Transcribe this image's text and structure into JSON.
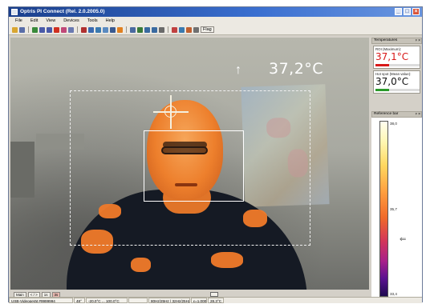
{
  "window": {
    "title": "Optris PI Connect (Rel. 2.0.2005.0)",
    "controls": [
      "_",
      "□",
      "×"
    ]
  },
  "menu": [
    "File",
    "Edit",
    "View",
    "Devices",
    "Tools",
    "Help"
  ],
  "toolbar": {
    "flag_label": "Flag",
    "icons": [
      {
        "name": "open-icon",
        "color": "#d9a630"
      },
      {
        "name": "save-icon",
        "color": "#5a6ea8"
      },
      {
        "name": "play-icon",
        "color": "#3a8a3a"
      },
      {
        "name": "pause-icon",
        "color": "#4a5aa8"
      },
      {
        "name": "stop-icon",
        "color": "#4a5aa8"
      },
      {
        "name": "record-icon",
        "color": "#d03020"
      },
      {
        "name": "snapshot-icon",
        "color": "#c04878"
      },
      {
        "name": "camera-icon",
        "color": "#6a7ab0"
      },
      {
        "name": "palette-icon",
        "color": "#b03030"
      },
      {
        "name": "grid-icon",
        "color": "#3a6ab0"
      },
      {
        "name": "layout-icon",
        "color": "#3a7ab0"
      },
      {
        "name": "zoom-icon",
        "color": "#5a8ac0"
      },
      {
        "name": "measure-icon",
        "color": "#3a5a90"
      },
      {
        "name": "hotspot-icon",
        "color": "#e08020"
      },
      {
        "name": "line-icon",
        "color": "#4a6aa0"
      },
      {
        "name": "graph-icon",
        "color": "#3a7a3a"
      },
      {
        "name": "temp-scale-icon",
        "color": "#3a6aa0"
      },
      {
        "name": "temp-range-icon",
        "color": "#3a6aa0"
      },
      {
        "name": "temp-grid-icon",
        "color": "#6a6a6a"
      },
      {
        "name": "export-icon",
        "color": "#c04040"
      },
      {
        "name": "settings-icon",
        "color": "#3a7ab0"
      },
      {
        "name": "chart-icon",
        "color": "#c06030"
      },
      {
        "name": "tools-icon",
        "color": "#707070"
      }
    ]
  },
  "view": {
    "max_temperature": "37,2°C",
    "up_arrow": "↑"
  },
  "bottom_controls": {
    "main_btn": "Main",
    "nav_btn": "< / >",
    "one_btn": "1s",
    "rec_btn": "3s"
  },
  "statusbar": {
    "device": "USB-Videogerät #9999994",
    "fov": "48°",
    "range": "-20,0°C ... 100,0°C",
    "framerate": "80Hz/25Hz | 32Hz/25Hz",
    "emissivity": "ε=1,000",
    "ambient": "28,3°C"
  },
  "temperatures_panel": {
    "title": "Temperatures",
    "roi": {
      "label": "ROI (Maximum):",
      "value": "37,1°C",
      "color": "#d81818",
      "level_pct": 30
    },
    "hotspot": {
      "label": "Hot spot (Mean value):",
      "value": "37,0°C",
      "color": "#111111",
      "level_pct": 30,
      "bar_color": "#2a9a2a"
    }
  },
  "reference_bar": {
    "title": "Reference bar",
    "ticks": [
      "38,0",
      "35,7",
      "33,4"
    ]
  }
}
